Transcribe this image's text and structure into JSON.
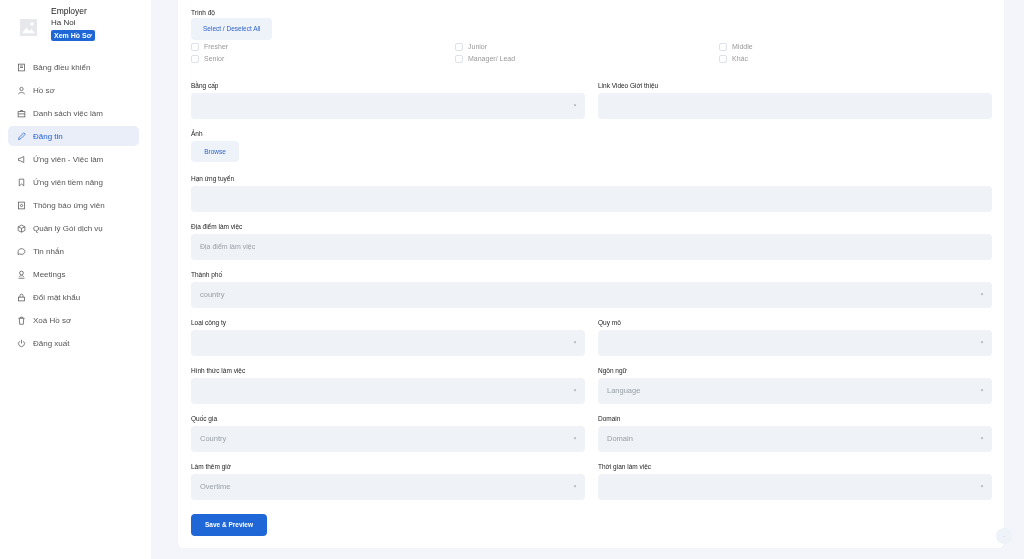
{
  "profile": {
    "name": "Employer",
    "location": "Ha Noi",
    "view_button": "Xem Hồ Sơ"
  },
  "sidebar": {
    "items": [
      {
        "label": "Bảng điều khiển",
        "selected": false
      },
      {
        "label": "Hồ sơ",
        "selected": false
      },
      {
        "label": "Danh sách việc làm",
        "selected": false
      },
      {
        "label": "Đăng tin",
        "selected": true
      },
      {
        "label": "Ứng viên - Việc làm",
        "selected": false
      },
      {
        "label": "Ứng viên tiềm năng",
        "selected": false
      },
      {
        "label": "Thông báo ứng viên",
        "selected": false
      },
      {
        "label": "Quản lý Gói dịch vụ",
        "selected": false
      },
      {
        "label": "Tin nhắn",
        "selected": false
      },
      {
        "label": "Meetings",
        "selected": false
      },
      {
        "label": "Đổi mật khẩu",
        "selected": false
      },
      {
        "label": "Xoá Hồ sơ",
        "selected": false
      },
      {
        "label": "Đăng xuất",
        "selected": false
      }
    ]
  },
  "level": {
    "label": "Trình độ",
    "select_all": "Select / Deselect All",
    "options": [
      {
        "label": "Fresher",
        "checked": false
      },
      {
        "label": "Junior",
        "checked": false
      },
      {
        "label": "Middle",
        "checked": false
      },
      {
        "label": "Senior",
        "checked": false
      },
      {
        "label": "Manager/ Lead",
        "checked": false
      },
      {
        "label": "Khác",
        "checked": false
      }
    ]
  },
  "rows": [
    [
      {
        "label": "Bằng cấp",
        "kind": "select"
      },
      {
        "label": "Link Video Giới thiệu",
        "kind": "input"
      }
    ],
    [
      {
        "label": "Ảnh",
        "kind": "file",
        "button": "Browse"
      }
    ],
    [
      {
        "label": "Hạn ứng tuyển",
        "kind": "input"
      }
    ],
    [
      {
        "label": "Địa điểm làm việc",
        "kind": "input",
        "placeholder": "Địa điểm làm việc"
      }
    ],
    [
      {
        "label": "Thành phố",
        "kind": "select",
        "placeholder": "country"
      }
    ],
    [
      {
        "label": "Loại công ty",
        "kind": "select"
      },
      {
        "label": "Quy mô",
        "kind": "select"
      }
    ],
    [
      {
        "label": "Hình thức làm việc",
        "kind": "select"
      },
      {
        "label": "Ngôn ngữ",
        "kind": "select",
        "placeholder": "Language"
      }
    ],
    [
      {
        "label": "Quốc gia",
        "kind": "select",
        "placeholder": "Country"
      },
      {
        "label": "Domain",
        "kind": "select",
        "placeholder": "Domain"
      }
    ],
    [
      {
        "label": "Làm thêm giờ",
        "kind": "select",
        "placeholder": "Overtime"
      },
      {
        "label": "Thời gian làm việc",
        "kind": "select"
      }
    ]
  ],
  "submit": "Save & Preview"
}
